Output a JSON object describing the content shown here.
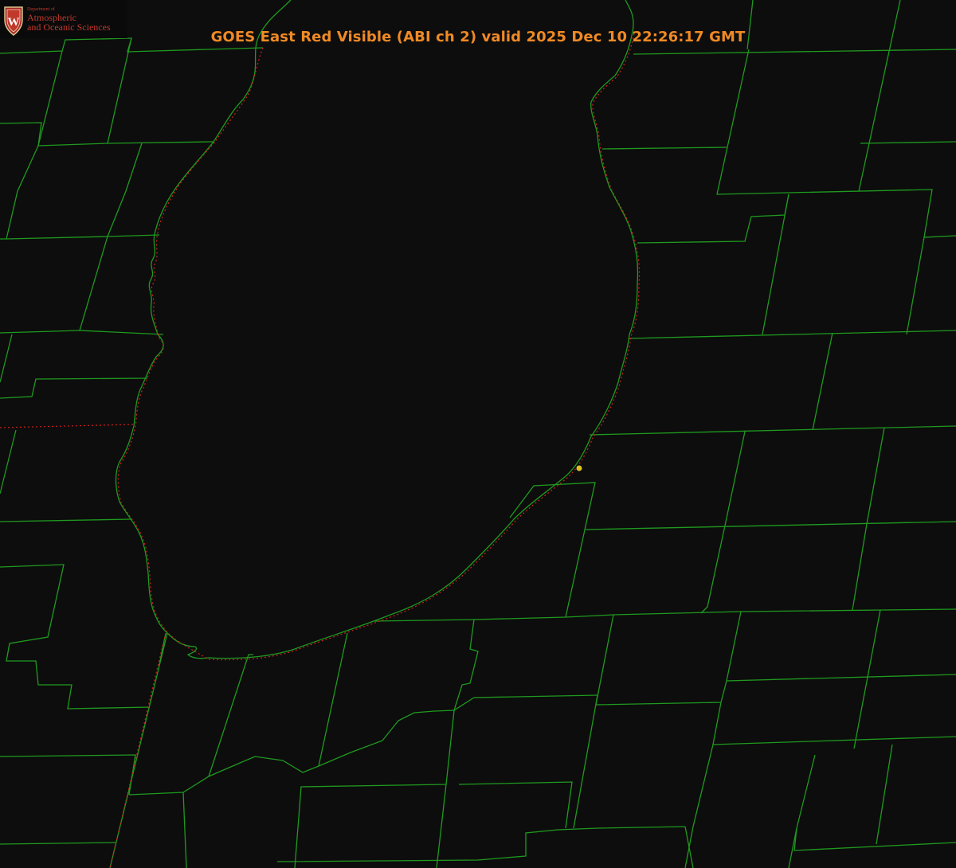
{
  "title": "GOES East Red Visible (ABI ch 2) valid 2025 Dec 10 22:26:17 GMT",
  "logo": {
    "department": "Department of",
    "line1": "Atmospheric",
    "line2": "and Oceanic Sciences",
    "shield_letter": "W"
  },
  "colors": {
    "background": "#0d0d0d",
    "county_lines": "#1f9a1f",
    "state_line": "#d02020",
    "title": "#f08a24",
    "marker": "#e0c020"
  },
  "map": {
    "satellite": "GOES East",
    "channel": "ABI ch 2",
    "marker_icon": "station-dot-icon"
  }
}
